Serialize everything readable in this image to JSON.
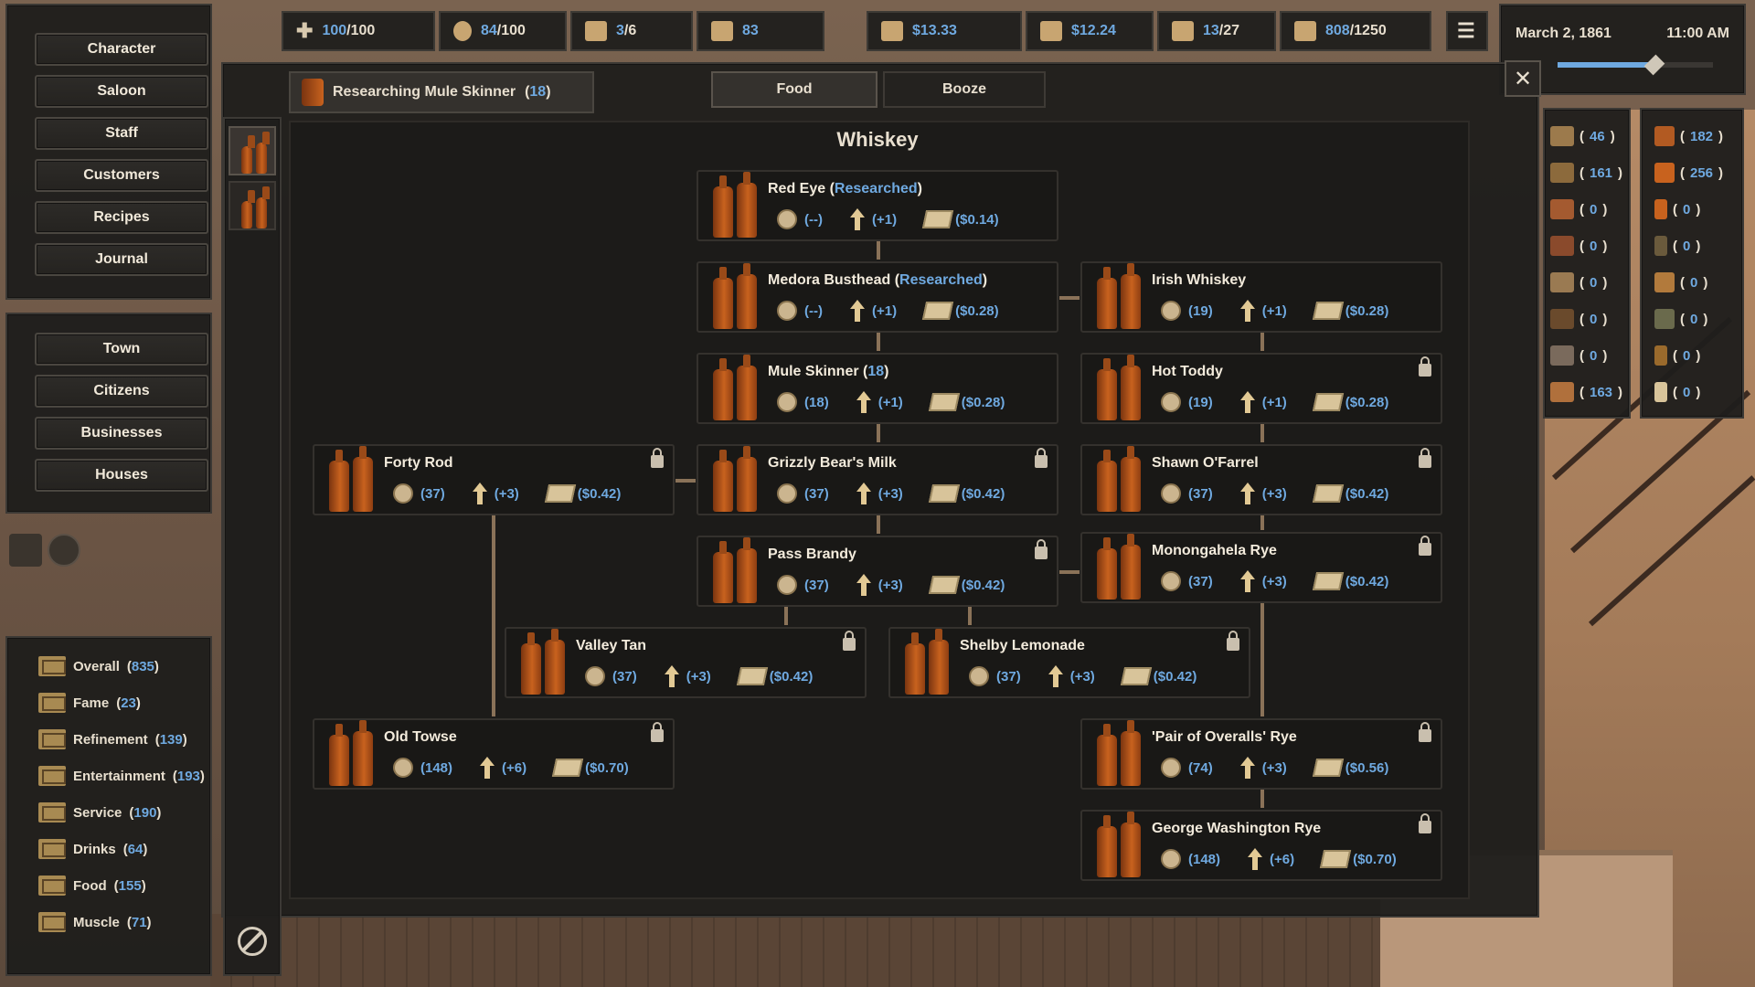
{
  "topbar": {
    "health": {
      "current": "100",
      "max": "/100"
    },
    "hunger": {
      "current": "84",
      "max": "/100"
    },
    "chat": {
      "current": "3",
      "max": "/6"
    },
    "reputation": "83",
    "cash": "$13.33",
    "income": "$12.24",
    "storage": {
      "current": "13",
      "max": "/27"
    },
    "crates": {
      "current": "808",
      "max": "/1250"
    }
  },
  "clock": {
    "date": "March 2, 1861",
    "time": "11:00 AM"
  },
  "menu_main": [
    "Character",
    "Saloon",
    "Staff",
    "Customers",
    "Recipes",
    "Journal"
  ],
  "menu_town": [
    "Town",
    "Citizens",
    "Businesses",
    "Houses"
  ],
  "stats": [
    {
      "label": "Overall",
      "value": "835"
    },
    {
      "label": "Fame",
      "value": "23"
    },
    {
      "label": "Refinement",
      "value": "139"
    },
    {
      "label": "Entertainment",
      "value": "193"
    },
    {
      "label": "Service",
      "value": "190"
    },
    {
      "label": "Drinks",
      "value": "64"
    },
    {
      "label": "Food",
      "value": "155"
    },
    {
      "label": "Muscle",
      "value": "71"
    }
  ],
  "research": {
    "label": "Researching Mule Skinner",
    "count": "18"
  },
  "tabs": {
    "food": "Food",
    "booze": "Booze"
  },
  "tree_title": "Whiskey",
  "nodes": {
    "red_eye": {
      "name": "Red Eye",
      "status": "Researched",
      "time": "--",
      "level": "+1",
      "price": "$0.14"
    },
    "medora": {
      "name": "Medora Busthead",
      "status": "Researched",
      "time": "--",
      "level": "+1",
      "price": "$0.28"
    },
    "irish": {
      "name": "Irish Whiskey",
      "time": "19",
      "level": "+1",
      "price": "$0.28"
    },
    "mule": {
      "name": "Mule Skinner",
      "count": "18",
      "time": "18",
      "level": "+1",
      "price": "$0.28"
    },
    "hot_toddy": {
      "name": "Hot Toddy",
      "time": "19",
      "level": "+1",
      "price": "$0.28"
    },
    "forty_rod": {
      "name": "Forty Rod",
      "time": "37",
      "level": "+3",
      "price": "$0.42"
    },
    "grizzly": {
      "name": "Grizzly Bear's Milk",
      "time": "37",
      "level": "+3",
      "price": "$0.42"
    },
    "shawn": {
      "name": "Shawn O'Farrel",
      "time": "37",
      "level": "+3",
      "price": "$0.42"
    },
    "pass_brandy": {
      "name": "Pass Brandy",
      "time": "37",
      "level": "+3",
      "price": "$0.42"
    },
    "monongahela": {
      "name": "Monongahela Rye",
      "time": "37",
      "level": "+3",
      "price": "$0.42"
    },
    "valley_tan": {
      "name": "Valley Tan",
      "time": "37",
      "level": "+3",
      "price": "$0.42"
    },
    "shelby": {
      "name": "Shelby Lemonade",
      "time": "37",
      "level": "+3",
      "price": "$0.42"
    },
    "old_towse": {
      "name": "Old Towse",
      "time": "148",
      "level": "+6",
      "price": "$0.70"
    },
    "pair_overalls": {
      "name": "'Pair of Overalls' Rye",
      "time": "74",
      "level": "+3",
      "price": "$0.56"
    },
    "george": {
      "name": "George Washington Rye",
      "time": "148",
      "level": "+6",
      "price": "$0.70"
    }
  },
  "ingredients_left": [
    "46",
    "161",
    "0",
    "0",
    "0",
    "0",
    "0",
    "163"
  ],
  "ingredients_right": [
    "182",
    "256",
    "0",
    "0",
    "0",
    "0",
    "0",
    "0"
  ],
  "colors": {
    "accent": "#6fa9e0",
    "panel": "#1f1e1c",
    "border": "#3c3935",
    "bottle": "#c8621e"
  }
}
